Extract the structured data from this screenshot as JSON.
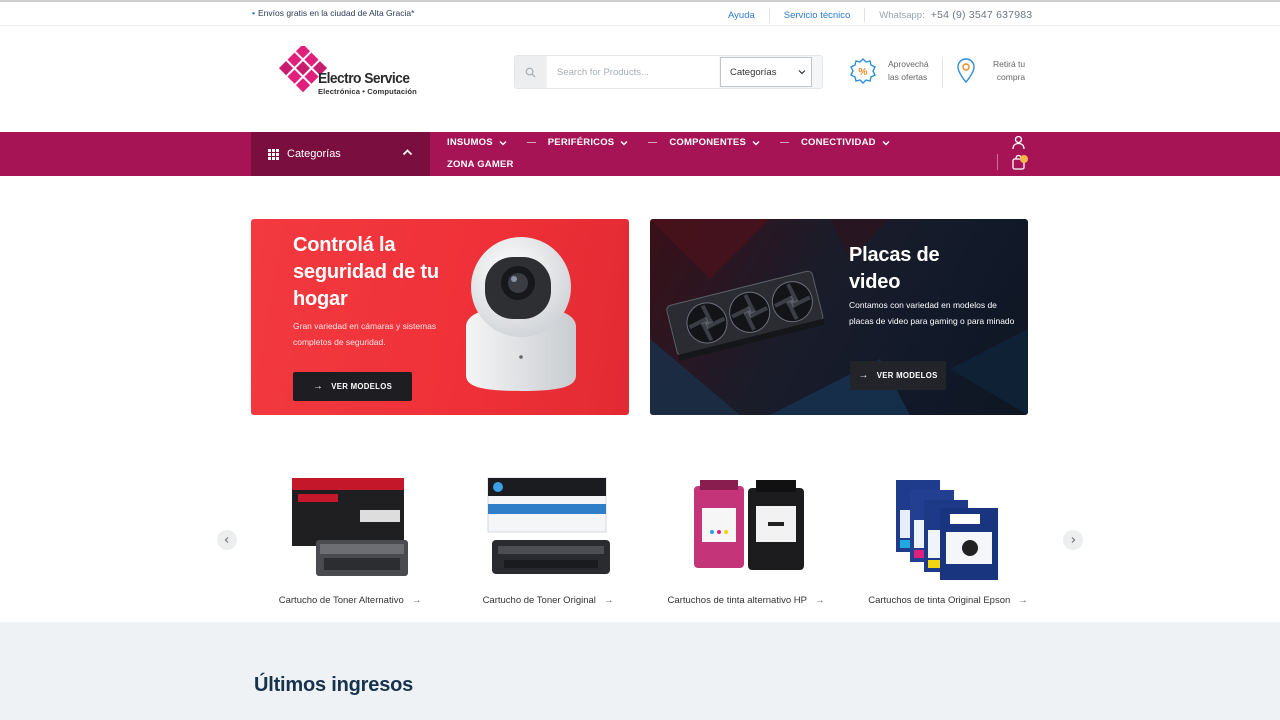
{
  "topbar": {
    "promo_text": "Envíos gratis en la ciudad de Alta Gracia*",
    "help_link": "Ayuda",
    "service_link": "Servicio técnico",
    "whatsapp_label": "Whatsapp:",
    "whatsapp_number": "+54 (9) 3547 637983"
  },
  "header": {
    "brand_name": "Electro Service",
    "brand_tagline": "Electrónica • Computación",
    "search_placeholder": "Search for Products...",
    "category_select": "Categorías",
    "perk_offers_line1": "Aprovechá",
    "perk_offers_line2": "las ofertas",
    "perk_pickup_line1": "Retirá tu",
    "perk_pickup_line2": "compra"
  },
  "nav": {
    "categories_label": "Categorías",
    "items": [
      {
        "label": "INSUMOS"
      },
      {
        "label": "PERIFÉRICOS"
      },
      {
        "label": "COMPONENTES"
      },
      {
        "label": "CONECTIVIDAD"
      }
    ],
    "zona_gamer": "ZONA GAMER",
    "cart_count_color": "#f6b64a"
  },
  "banners": [
    {
      "title": "Controlá la seguridad de tu hogar",
      "text": "Gran variedad en cámaras y sistemas completos de seguridad.",
      "button": "VER MODELOS",
      "color": "#f23a40"
    },
    {
      "title": "Placas de video",
      "text": "Contamos con variedad en modelos de placas de video para gaming o para minado",
      "button": "VER MODELOS",
      "color": "#121a2a"
    }
  ],
  "products": [
    {
      "name": "Cartucho de Toner Alternativo"
    },
    {
      "name": "Cartucho de Toner Original"
    },
    {
      "name": "Cartuchos de tinta alternativo HP"
    },
    {
      "name": "Cartuchos de tinta Original Epson"
    }
  ],
  "latest": {
    "title": "Últimos ingresos"
  },
  "colors": {
    "brand": "#a71456",
    "brand_dark": "#7a0f3f",
    "link": "#2e7bd6",
    "heading": "#17324d"
  }
}
